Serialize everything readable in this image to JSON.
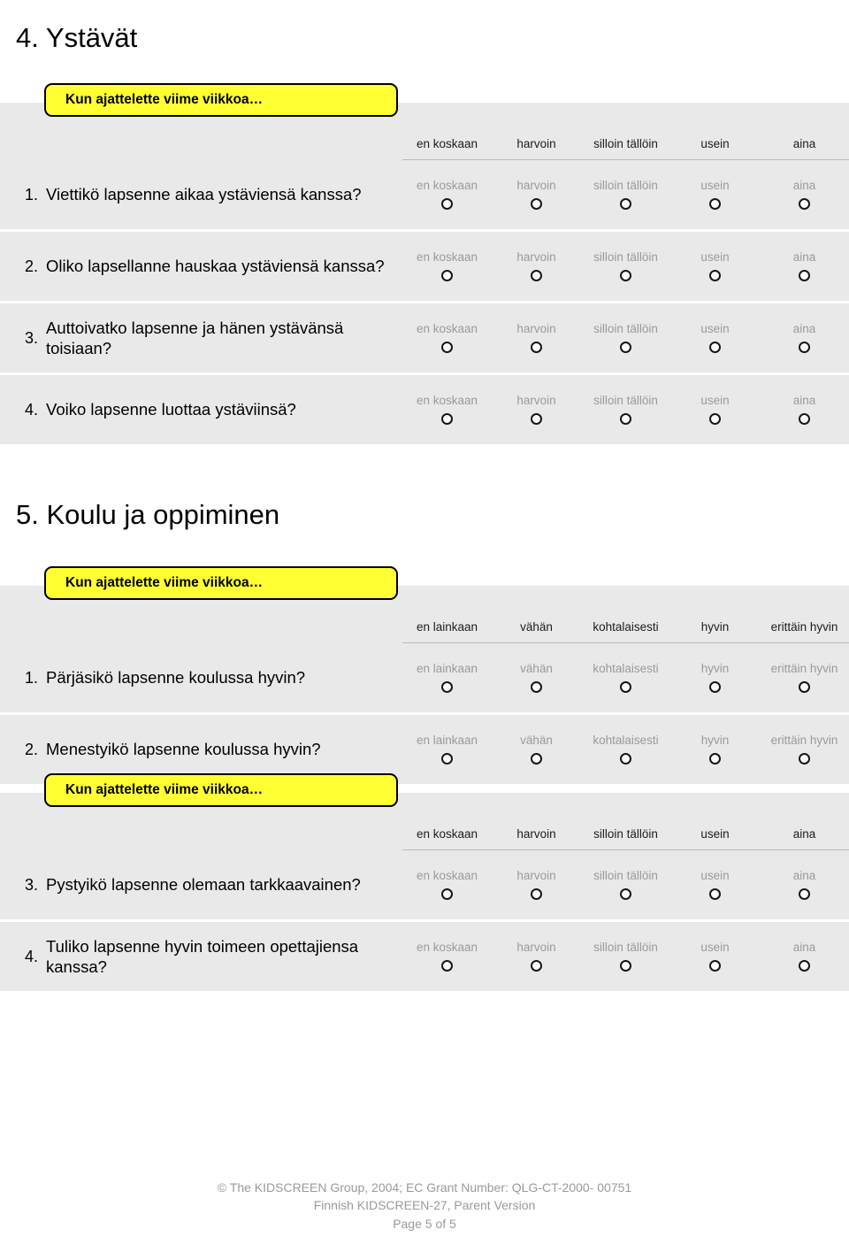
{
  "document": {
    "sections": [
      {
        "heading": "4. Ystävät",
        "blocks": [
          {
            "banner": "Kun ajattelette viime viikkoa…",
            "scale": [
              "en koskaan",
              "harvoin",
              "silloin tällöin",
              "usein",
              "aina"
            ],
            "questions": [
              {
                "number": "1.",
                "text": "Viettikö lapsenne aikaa ystäviensä kanssa?"
              },
              {
                "number": "2.",
                "text": "Oliko lapsellanne hauskaa ystäviensä kanssa?"
              },
              {
                "number": "3.",
                "text": "Auttoivatko lapsenne ja hänen ystävänsä toisiaan?"
              },
              {
                "number": "4.",
                "text": "Voiko lapsenne luottaa ystäviinsä?"
              }
            ]
          }
        ]
      },
      {
        "heading": "5. Koulu ja oppiminen",
        "blocks": [
          {
            "banner": "Kun ajattelette viime viikkoa…",
            "scale": [
              "en lainkaan",
              "vähän",
              "kohtalaisesti",
              "hyvin",
              "erittäin hyvin"
            ],
            "questions": [
              {
                "number": "1.",
                "text": "Pärjäsikö lapsenne koulussa hyvin?"
              },
              {
                "number": "2.",
                "text": "Menestyikö lapsenne koulussa hyvin?"
              }
            ]
          },
          {
            "banner": "Kun ajattelette viime viikkoa…",
            "scale": [
              "en koskaan",
              "harvoin",
              "silloin tällöin",
              "usein",
              "aina"
            ],
            "questions": [
              {
                "number": "3.",
                "text": "Pystyikö lapsenne olemaan tarkkaavainen?"
              },
              {
                "number": "4.",
                "text": "Tuliko lapsenne hyvin toimeen opettajiensa kanssa?"
              }
            ]
          }
        ]
      }
    ],
    "footer": {
      "copyright": "© The KIDSCREEN Group, 2004; EC Grant Number: QLG-CT-2000- 00751",
      "version": "Finnish KIDSCREEN-27, Parent Version",
      "page": "Page 5 of 5"
    },
    "colors": {
      "banner_background": "#ffff33",
      "matrix_background": "#e9e9e9",
      "scale_label_muted": "#9a9a9a",
      "footer_text": "#9a9a9a"
    }
  }
}
